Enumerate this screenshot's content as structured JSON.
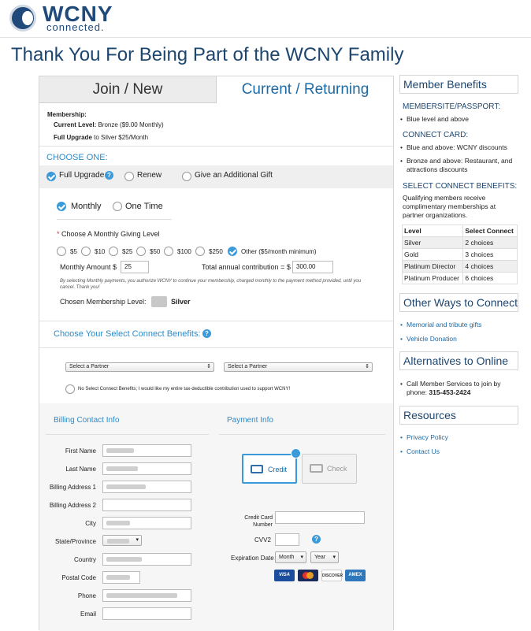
{
  "header": {
    "logo_text": "WCNY",
    "logo_sub": "connected."
  },
  "page": {
    "title": "Thank You For Being Part of the WCNY Family"
  },
  "tabs": {
    "join": "Join / New",
    "current": "Current / Returning"
  },
  "membership": {
    "label": "Membership:",
    "current_label": "Current Level:",
    "current_value": "Bronze ($9.00 Monthly)",
    "upgrade_label": "Full Upgrade",
    "upgrade_value": "to Silver $25/Month"
  },
  "choose": {
    "heading": "CHOOSE ONE:",
    "options": [
      "Full Upgrade",
      "Renew",
      "Give an Additional Gift"
    ]
  },
  "frequency": {
    "monthly": "Monthly",
    "one_time": "One Time"
  },
  "giving": {
    "label": "Choose A Monthly Giving Level",
    "required_mark": "*",
    "amounts": [
      "$5",
      "$10",
      "$25",
      "$50",
      "$100",
      "$250"
    ],
    "other": "Other ($5/month minimum)",
    "monthly_amount_label": "Monthly Amount $",
    "monthly_amount_value": "25",
    "annual_label": "Total annual contribution = $",
    "annual_value": "300.00",
    "disclaimer": "By selecting Monthly payments, you authorize WCNY to continue your membership, charged monthly to the payment method provided, until you cancel. Thank you!",
    "chosen_label": "Chosen Membership Level:",
    "chosen_value": "Silver"
  },
  "connect": {
    "heading": "Choose Your Select Connect Benefits:",
    "partner_placeholder_1": "Select a Partner",
    "partner_placeholder_2": "Select a Partner",
    "no_benefits": "No Select Connect Benefits; I would like my entire tax-deductible contribution used to support WCNY!"
  },
  "billing": {
    "heading": "Billing Contact Info",
    "fields": [
      "First Name",
      "Last Name",
      "Billing Address 1",
      "Billing Address 2",
      "City",
      "State/Province",
      "Country",
      "Postal Code",
      "Phone",
      "Email"
    ]
  },
  "payment": {
    "heading": "Payment Info",
    "credit": "Credit",
    "check": "Check",
    "cards": [
      "VISA",
      "MC",
      "DISCOVER",
      "AMEX"
    ],
    "card_number_label": "Credit Card Number",
    "cvv_label": "CVV2",
    "expiration_label": "Expiration Date",
    "month": "Month",
    "year": "Year"
  },
  "sidebar": {
    "benefits_title": "Member Benefits",
    "membersite_h": "MEMBERSITE/PASSPORT:",
    "membersite_items": [
      "Blue level and above"
    ],
    "connect_card_h": "CONNECT CARD:",
    "connect_card_items": [
      "Blue and above: WCNY discounts",
      "Bronze and above: Restaurant, and attractions discounts"
    ],
    "select_h": "SELECT CONNECT BENEFITS:",
    "select_desc": "Qualifying members receive complimentary memberships at partner organizations.",
    "table_headers": [
      "Level",
      "Select Connect"
    ],
    "table_rows": [
      [
        "Silver",
        "2 choices"
      ],
      [
        "Gold",
        "3 choices"
      ],
      [
        "Platinum Director",
        "4 choices"
      ],
      [
        "Platinum Producer",
        "6 choices"
      ]
    ],
    "other_title": "Other Ways to Connect",
    "other_links": [
      "Memorial and tribute gifts",
      "Vehicle Donation"
    ],
    "alt_title": "Alternatives to Online",
    "alt_text": "Call Member Services to join by phone:",
    "alt_phone": "315-453-2424",
    "resources_title": "Resources",
    "resources_links": [
      "Privacy Policy",
      "Contact Us"
    ]
  },
  "colors": {
    "brand": "#1d466f",
    "accent": "#2f8ac6",
    "check": "#3b9ad9"
  }
}
